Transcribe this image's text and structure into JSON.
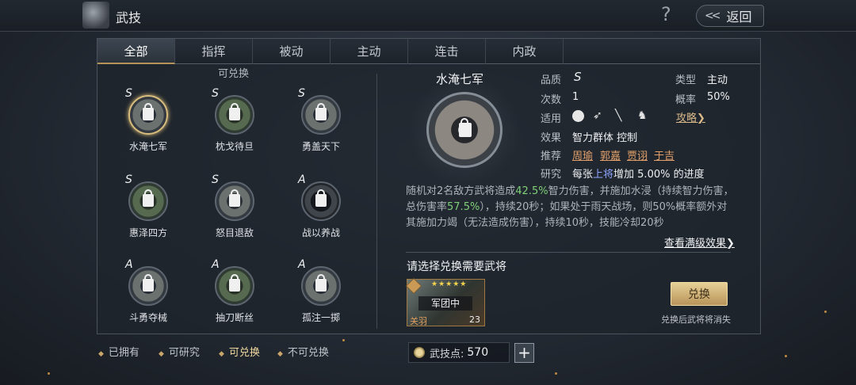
{
  "header": {
    "title": "武技",
    "help_icon": "?",
    "back_label": "返回"
  },
  "tabs": [
    "全部",
    "指挥",
    "被动",
    "主动",
    "连击",
    "内政"
  ],
  "list_section_title": "可兑换",
  "skills": [
    {
      "name": "水淹七军",
      "grade": "S"
    },
    {
      "name": "枕戈待旦",
      "grade": "S"
    },
    {
      "name": "勇盖天下",
      "grade": "S"
    },
    {
      "name": "惠泽四方",
      "grade": "S"
    },
    {
      "name": "怒目退敌",
      "grade": "S"
    },
    {
      "name": "战以养战",
      "grade": "A"
    },
    {
      "name": "斗勇夺械",
      "grade": "A"
    },
    {
      "name": "抽刀断丝",
      "grade": "A"
    },
    {
      "name": "孤注一掷",
      "grade": "A"
    }
  ],
  "legend": [
    "已拥有",
    "可研究",
    "可兑换",
    "不可兑换"
  ],
  "points": {
    "label": "武技点:",
    "value": "570",
    "add": "+"
  },
  "detail": {
    "name": "水淹七军",
    "quality_label": "品质",
    "quality": "S",
    "count_label": "次数",
    "count": "1",
    "apply_label": "适用",
    "effect_label": "效果",
    "effect": "智力群体 控制",
    "recommend_label": "推荐",
    "recommend": [
      "周瑜",
      "郭嘉",
      "贾诩",
      "于吉"
    ],
    "research_label": "研究",
    "research_prefix": "每张",
    "research_highlight": "上将",
    "research_suffix": "增加 5.00% 的进度",
    "type_label": "类型",
    "type": "主动",
    "rate_label": "概率",
    "rate": "50%",
    "strategy": "攻略❯",
    "desc": {
      "p1": "随机对2名敌方武将造成",
      "v1": "42.5%",
      "p2": "智力伤害，并施加水浸（持续智力伤害，总伤害率",
      "v2": "57.5%",
      "p3": "），持续20秒；如果处于雨天战场，则50%概率额外对其施加力竭（无法造成伤害），持续10秒，技能冷却20秒"
    },
    "more": "查看满级效果❯",
    "choose_label": "请选择兑换需要武将",
    "general": {
      "status": "军团中",
      "name": "关羽",
      "level": "23",
      "stars": "★★★★★"
    },
    "exchange_button": "兑换",
    "exchange_note": "兑换后武将将消失"
  }
}
